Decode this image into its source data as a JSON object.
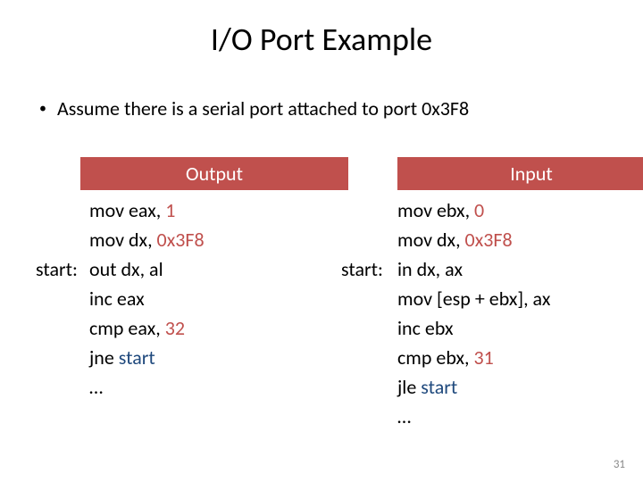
{
  "title": "I/O Port Example",
  "bullet": "Assume there is a serial port attached to port 0x3F8",
  "output": {
    "header": "Output",
    "label": "start:",
    "lines": [
      {
        "p1": "mov eax, ",
        "num": "1"
      },
      {
        "p1": "mov dx, ",
        "num": "0x3F8"
      },
      {
        "p1": "out dx, al"
      },
      {
        "p1": "inc eax"
      },
      {
        "p1": "cmp eax, ",
        "num": "32"
      },
      {
        "p1": "jne ",
        "ref": "start"
      },
      {
        "p1": "…"
      }
    ]
  },
  "input": {
    "header": "Input",
    "label": "start:",
    "lines": [
      {
        "p1": "mov ebx, ",
        "num": "0"
      },
      {
        "p1": "mov dx, ",
        "num": "0x3F8"
      },
      {
        "p1": "in dx, ax"
      },
      {
        "p1": "mov [esp + ebx], ax"
      },
      {
        "p1": "inc ebx"
      },
      {
        "p1": "cmp ebx, ",
        "num": "31"
      },
      {
        "p1": "jle ",
        "ref": "start"
      },
      {
        "p1": "…"
      }
    ]
  },
  "pageNumber": "31"
}
